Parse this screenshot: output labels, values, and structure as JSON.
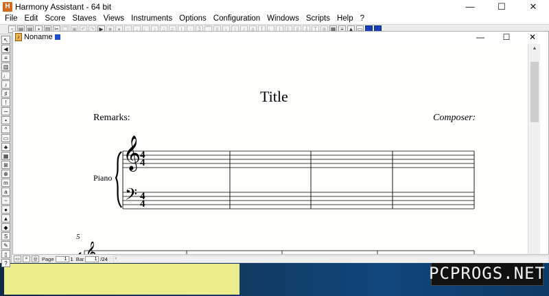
{
  "window": {
    "title": "Harmony Assistant - 64 bit",
    "icon": "H",
    "min": "—",
    "max": "☐",
    "close": "✕"
  },
  "menu": [
    "File",
    "Edit",
    "Score",
    "Staves",
    "Views",
    "Instruments",
    "Options",
    "Configuration",
    "Windows",
    "Scripts",
    "Help",
    "?"
  ],
  "document": {
    "title": "Noname",
    "min": "—",
    "max": "☐",
    "close": "✕"
  },
  "score": {
    "title": "Title",
    "remarks": "Remarks:",
    "composer": "Composer:",
    "instrument": "Piano",
    "time_signature_top": "4",
    "time_signature_bottom": "4",
    "next_system_measure_number": "5"
  },
  "statusbar": {
    "page_label": "Page",
    "page_value": "1",
    "page_total": "1",
    "bar_label": "Bar",
    "bar_value": "1",
    "bar_total": "/24"
  },
  "watermark": "PCPROGS.NET",
  "colors": {
    "yellow_panel": "#ecec8c",
    "accent_blue": "#1a3fb2",
    "desktop": "#0d3557"
  }
}
